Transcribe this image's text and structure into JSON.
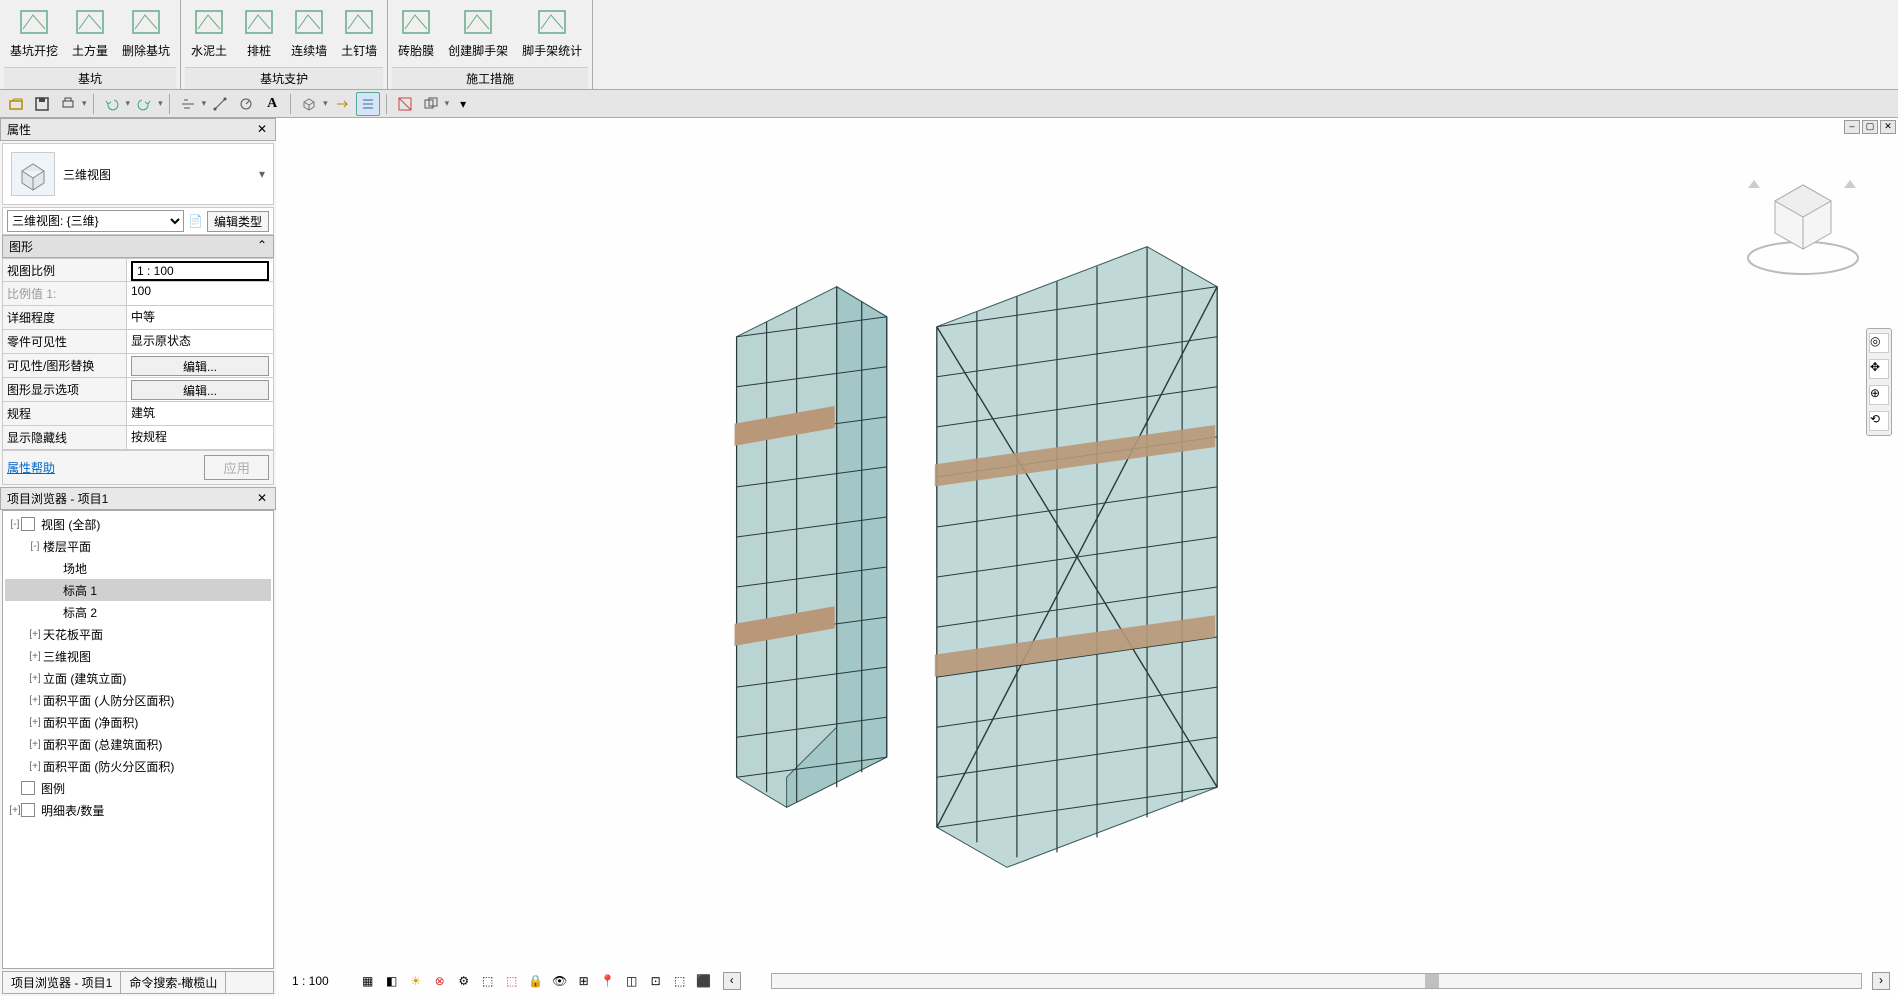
{
  "ribbon": {
    "panels": [
      {
        "title": "基坑",
        "buttons": [
          {
            "label": "基坑开挖",
            "icon": "excavate"
          },
          {
            "label": "土方量",
            "icon": "volume"
          },
          {
            "label": "删除基坑",
            "icon": "delete-pit"
          }
        ]
      },
      {
        "title": "基坑支护",
        "buttons": [
          {
            "label": "水泥土",
            "icon": "cement"
          },
          {
            "label": "排桩",
            "icon": "piles"
          },
          {
            "label": "连续墙",
            "icon": "wall"
          },
          {
            "label": "土钉墙",
            "icon": "nail"
          }
        ]
      },
      {
        "title": "施工措施",
        "buttons": [
          {
            "label": "砖胎膜",
            "icon": "brick"
          },
          {
            "label": "创建脚手架",
            "icon": "scaffold-create"
          },
          {
            "label": "脚手架统计",
            "icon": "scaffold-stat"
          }
        ]
      }
    ]
  },
  "properties": {
    "title": "属性",
    "type_selector": "三维视图",
    "instance": "三维视图: {三维}",
    "edit_type": "编辑类型",
    "group": "图形",
    "rows": [
      {
        "key": "视图比例",
        "val": "1 : 100",
        "type": "input"
      },
      {
        "key": "比例值 1:",
        "val": "100",
        "dim": true
      },
      {
        "key": "详细程度",
        "val": "中等"
      },
      {
        "key": "零件可见性",
        "val": "显示原状态"
      },
      {
        "key": "可见性/图形替换",
        "val": "编辑...",
        "type": "button"
      },
      {
        "key": "图形显示选项",
        "val": "编辑...",
        "type": "button"
      },
      {
        "key": "规程",
        "val": "建筑"
      },
      {
        "key": "显示隐藏线",
        "val": "按规程"
      }
    ],
    "help": "属性帮助",
    "apply": "应用"
  },
  "browser": {
    "title": "项目浏览器 - 项目1",
    "nodes": [
      {
        "level": 0,
        "toggle": "-",
        "label": "视图 (全部)",
        "icon": true
      },
      {
        "level": 1,
        "toggle": "-",
        "label": "楼层平面"
      },
      {
        "level": 2,
        "toggle": "",
        "label": "场地"
      },
      {
        "level": 2,
        "toggle": "",
        "label": "标高 1",
        "sel": true
      },
      {
        "level": 2,
        "toggle": "",
        "label": "标高 2"
      },
      {
        "level": 1,
        "toggle": "+",
        "label": "天花板平面"
      },
      {
        "level": 1,
        "toggle": "+",
        "label": "三维视图"
      },
      {
        "level": 1,
        "toggle": "+",
        "label": "立面 (建筑立面)"
      },
      {
        "level": 1,
        "toggle": "+",
        "label": "面积平面 (人防分区面积)"
      },
      {
        "level": 1,
        "toggle": "+",
        "label": "面积平面 (净面积)"
      },
      {
        "level": 1,
        "toggle": "+",
        "label": "面积平面 (总建筑面积)"
      },
      {
        "level": 1,
        "toggle": "+",
        "label": "面积平面 (防火分区面积)"
      },
      {
        "level": 0,
        "toggle": "",
        "label": "图例",
        "icon": true
      },
      {
        "level": 0,
        "toggle": "+",
        "label": "明细表/数量",
        "icon": true
      }
    ],
    "footer_left": "项目浏览器 - 项目1",
    "footer_right": "命令搜索-橄榄山"
  },
  "statusbar": {
    "scale": "1 : 100"
  }
}
